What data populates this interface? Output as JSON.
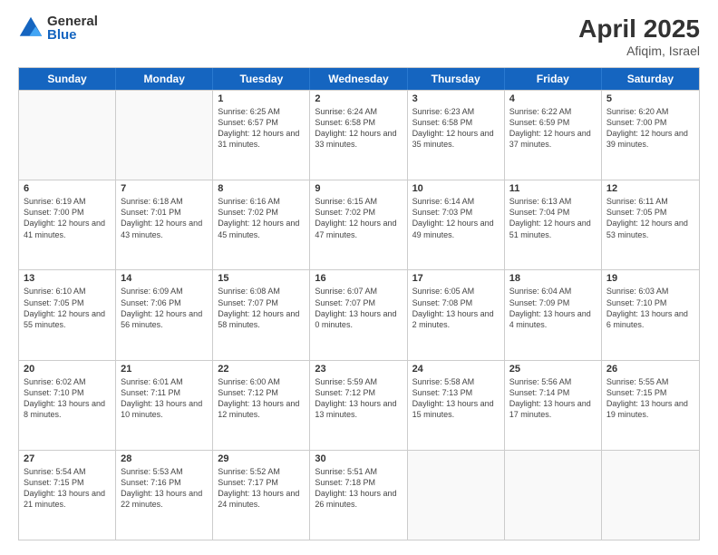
{
  "logo": {
    "general": "General",
    "blue": "Blue"
  },
  "title": "April 2025",
  "location": "Afiqim, Israel",
  "days_of_week": [
    "Sunday",
    "Monday",
    "Tuesday",
    "Wednesday",
    "Thursday",
    "Friday",
    "Saturday"
  ],
  "weeks": [
    [
      {
        "day": "",
        "empty": true
      },
      {
        "day": "",
        "empty": true
      },
      {
        "day": "1",
        "sunrise": "6:25 AM",
        "sunset": "6:57 PM",
        "daylight": "12 hours and 31 minutes."
      },
      {
        "day": "2",
        "sunrise": "6:24 AM",
        "sunset": "6:58 PM",
        "daylight": "12 hours and 33 minutes."
      },
      {
        "day": "3",
        "sunrise": "6:23 AM",
        "sunset": "6:58 PM",
        "daylight": "12 hours and 35 minutes."
      },
      {
        "day": "4",
        "sunrise": "6:22 AM",
        "sunset": "6:59 PM",
        "daylight": "12 hours and 37 minutes."
      },
      {
        "day": "5",
        "sunrise": "6:20 AM",
        "sunset": "7:00 PM",
        "daylight": "12 hours and 39 minutes."
      }
    ],
    [
      {
        "day": "6",
        "sunrise": "6:19 AM",
        "sunset": "7:00 PM",
        "daylight": "12 hours and 41 minutes."
      },
      {
        "day": "7",
        "sunrise": "6:18 AM",
        "sunset": "7:01 PM",
        "daylight": "12 hours and 43 minutes."
      },
      {
        "day": "8",
        "sunrise": "6:16 AM",
        "sunset": "7:02 PM",
        "daylight": "12 hours and 45 minutes."
      },
      {
        "day": "9",
        "sunrise": "6:15 AM",
        "sunset": "7:02 PM",
        "daylight": "12 hours and 47 minutes."
      },
      {
        "day": "10",
        "sunrise": "6:14 AM",
        "sunset": "7:03 PM",
        "daylight": "12 hours and 49 minutes."
      },
      {
        "day": "11",
        "sunrise": "6:13 AM",
        "sunset": "7:04 PM",
        "daylight": "12 hours and 51 minutes."
      },
      {
        "day": "12",
        "sunrise": "6:11 AM",
        "sunset": "7:05 PM",
        "daylight": "12 hours and 53 minutes."
      }
    ],
    [
      {
        "day": "13",
        "sunrise": "6:10 AM",
        "sunset": "7:05 PM",
        "daylight": "12 hours and 55 minutes."
      },
      {
        "day": "14",
        "sunrise": "6:09 AM",
        "sunset": "7:06 PM",
        "daylight": "12 hours and 56 minutes."
      },
      {
        "day": "15",
        "sunrise": "6:08 AM",
        "sunset": "7:07 PM",
        "daylight": "12 hours and 58 minutes."
      },
      {
        "day": "16",
        "sunrise": "6:07 AM",
        "sunset": "7:07 PM",
        "daylight": "13 hours and 0 minutes."
      },
      {
        "day": "17",
        "sunrise": "6:05 AM",
        "sunset": "7:08 PM",
        "daylight": "13 hours and 2 minutes."
      },
      {
        "day": "18",
        "sunrise": "6:04 AM",
        "sunset": "7:09 PM",
        "daylight": "13 hours and 4 minutes."
      },
      {
        "day": "19",
        "sunrise": "6:03 AM",
        "sunset": "7:10 PM",
        "daylight": "13 hours and 6 minutes."
      }
    ],
    [
      {
        "day": "20",
        "sunrise": "6:02 AM",
        "sunset": "7:10 PM",
        "daylight": "13 hours and 8 minutes."
      },
      {
        "day": "21",
        "sunrise": "6:01 AM",
        "sunset": "7:11 PM",
        "daylight": "13 hours and 10 minutes."
      },
      {
        "day": "22",
        "sunrise": "6:00 AM",
        "sunset": "7:12 PM",
        "daylight": "13 hours and 12 minutes."
      },
      {
        "day": "23",
        "sunrise": "5:59 AM",
        "sunset": "7:12 PM",
        "daylight": "13 hours and 13 minutes."
      },
      {
        "day": "24",
        "sunrise": "5:58 AM",
        "sunset": "7:13 PM",
        "daylight": "13 hours and 15 minutes."
      },
      {
        "day": "25",
        "sunrise": "5:56 AM",
        "sunset": "7:14 PM",
        "daylight": "13 hours and 17 minutes."
      },
      {
        "day": "26",
        "sunrise": "5:55 AM",
        "sunset": "7:15 PM",
        "daylight": "13 hours and 19 minutes."
      }
    ],
    [
      {
        "day": "27",
        "sunrise": "5:54 AM",
        "sunset": "7:15 PM",
        "daylight": "13 hours and 21 minutes."
      },
      {
        "day": "28",
        "sunrise": "5:53 AM",
        "sunset": "7:16 PM",
        "daylight": "13 hours and 22 minutes."
      },
      {
        "day": "29",
        "sunrise": "5:52 AM",
        "sunset": "7:17 PM",
        "daylight": "13 hours and 24 minutes."
      },
      {
        "day": "30",
        "sunrise": "5:51 AM",
        "sunset": "7:18 PM",
        "daylight": "13 hours and 26 minutes."
      },
      {
        "day": "",
        "empty": true
      },
      {
        "day": "",
        "empty": true
      },
      {
        "day": "",
        "empty": true
      }
    ]
  ]
}
